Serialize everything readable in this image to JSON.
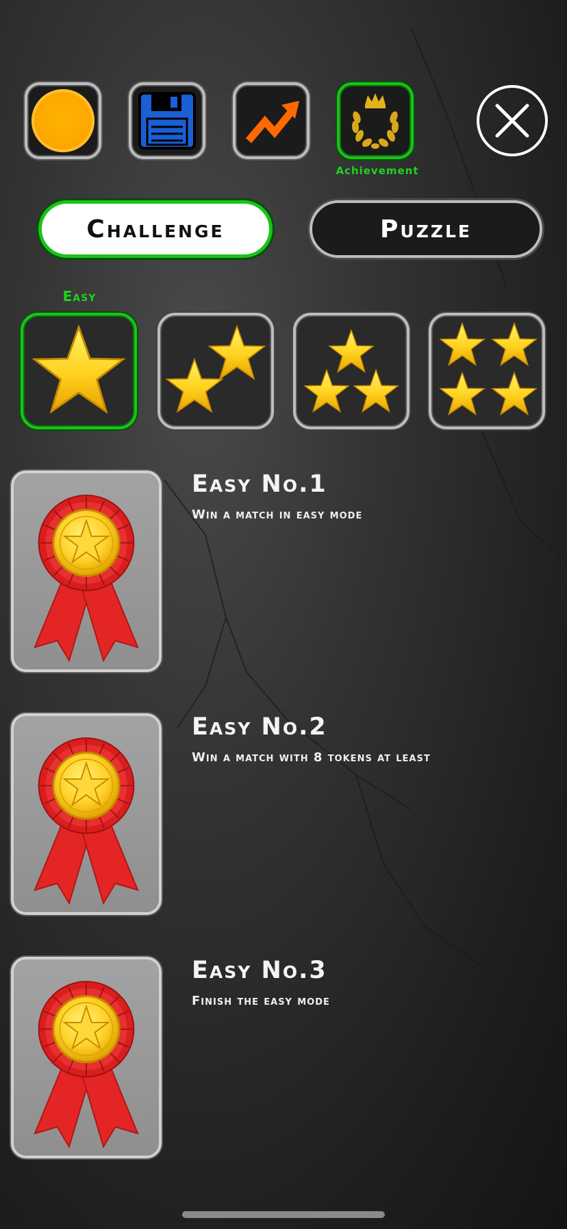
{
  "toolbar": {
    "buttons": [
      {
        "name": "coin",
        "icon": "coin-icon",
        "active": false
      },
      {
        "name": "save",
        "icon": "floppy-disk-icon",
        "active": false
      },
      {
        "name": "stats",
        "icon": "chart-arrow-icon",
        "active": false
      },
      {
        "name": "achievement",
        "icon": "laurel-crown-icon",
        "active": true
      }
    ],
    "active_label": "Achievement",
    "close_icon": "close-icon"
  },
  "modes": {
    "challenge_label": "Challenge",
    "puzzle_label": "Puzzle",
    "selected": "Challenge"
  },
  "difficulty": {
    "selected_label": "Easy",
    "levels": [
      {
        "stars": 1,
        "selected": true
      },
      {
        "stars": 2,
        "selected": false
      },
      {
        "stars": 3,
        "selected": false
      },
      {
        "stars": 4,
        "selected": false
      }
    ]
  },
  "achievements": [
    {
      "title": "Easy No.1",
      "description": "Win a match in easy mode",
      "icon": "ribbon-medal-icon"
    },
    {
      "title": "Easy No.2",
      "description": "Win a match with 8 tokens at least",
      "icon": "ribbon-medal-icon"
    },
    {
      "title": "Easy No.3",
      "description": "Finish the easy mode",
      "icon": "ribbon-medal-icon"
    }
  ],
  "colors": {
    "accent_green": "#19c419",
    "coin_orange": "#ffa800",
    "save_blue": "#1a5fd6",
    "stats_orange": "#ff6a00",
    "gold": "#ffd21f",
    "ribbon_red": "#e32525"
  }
}
